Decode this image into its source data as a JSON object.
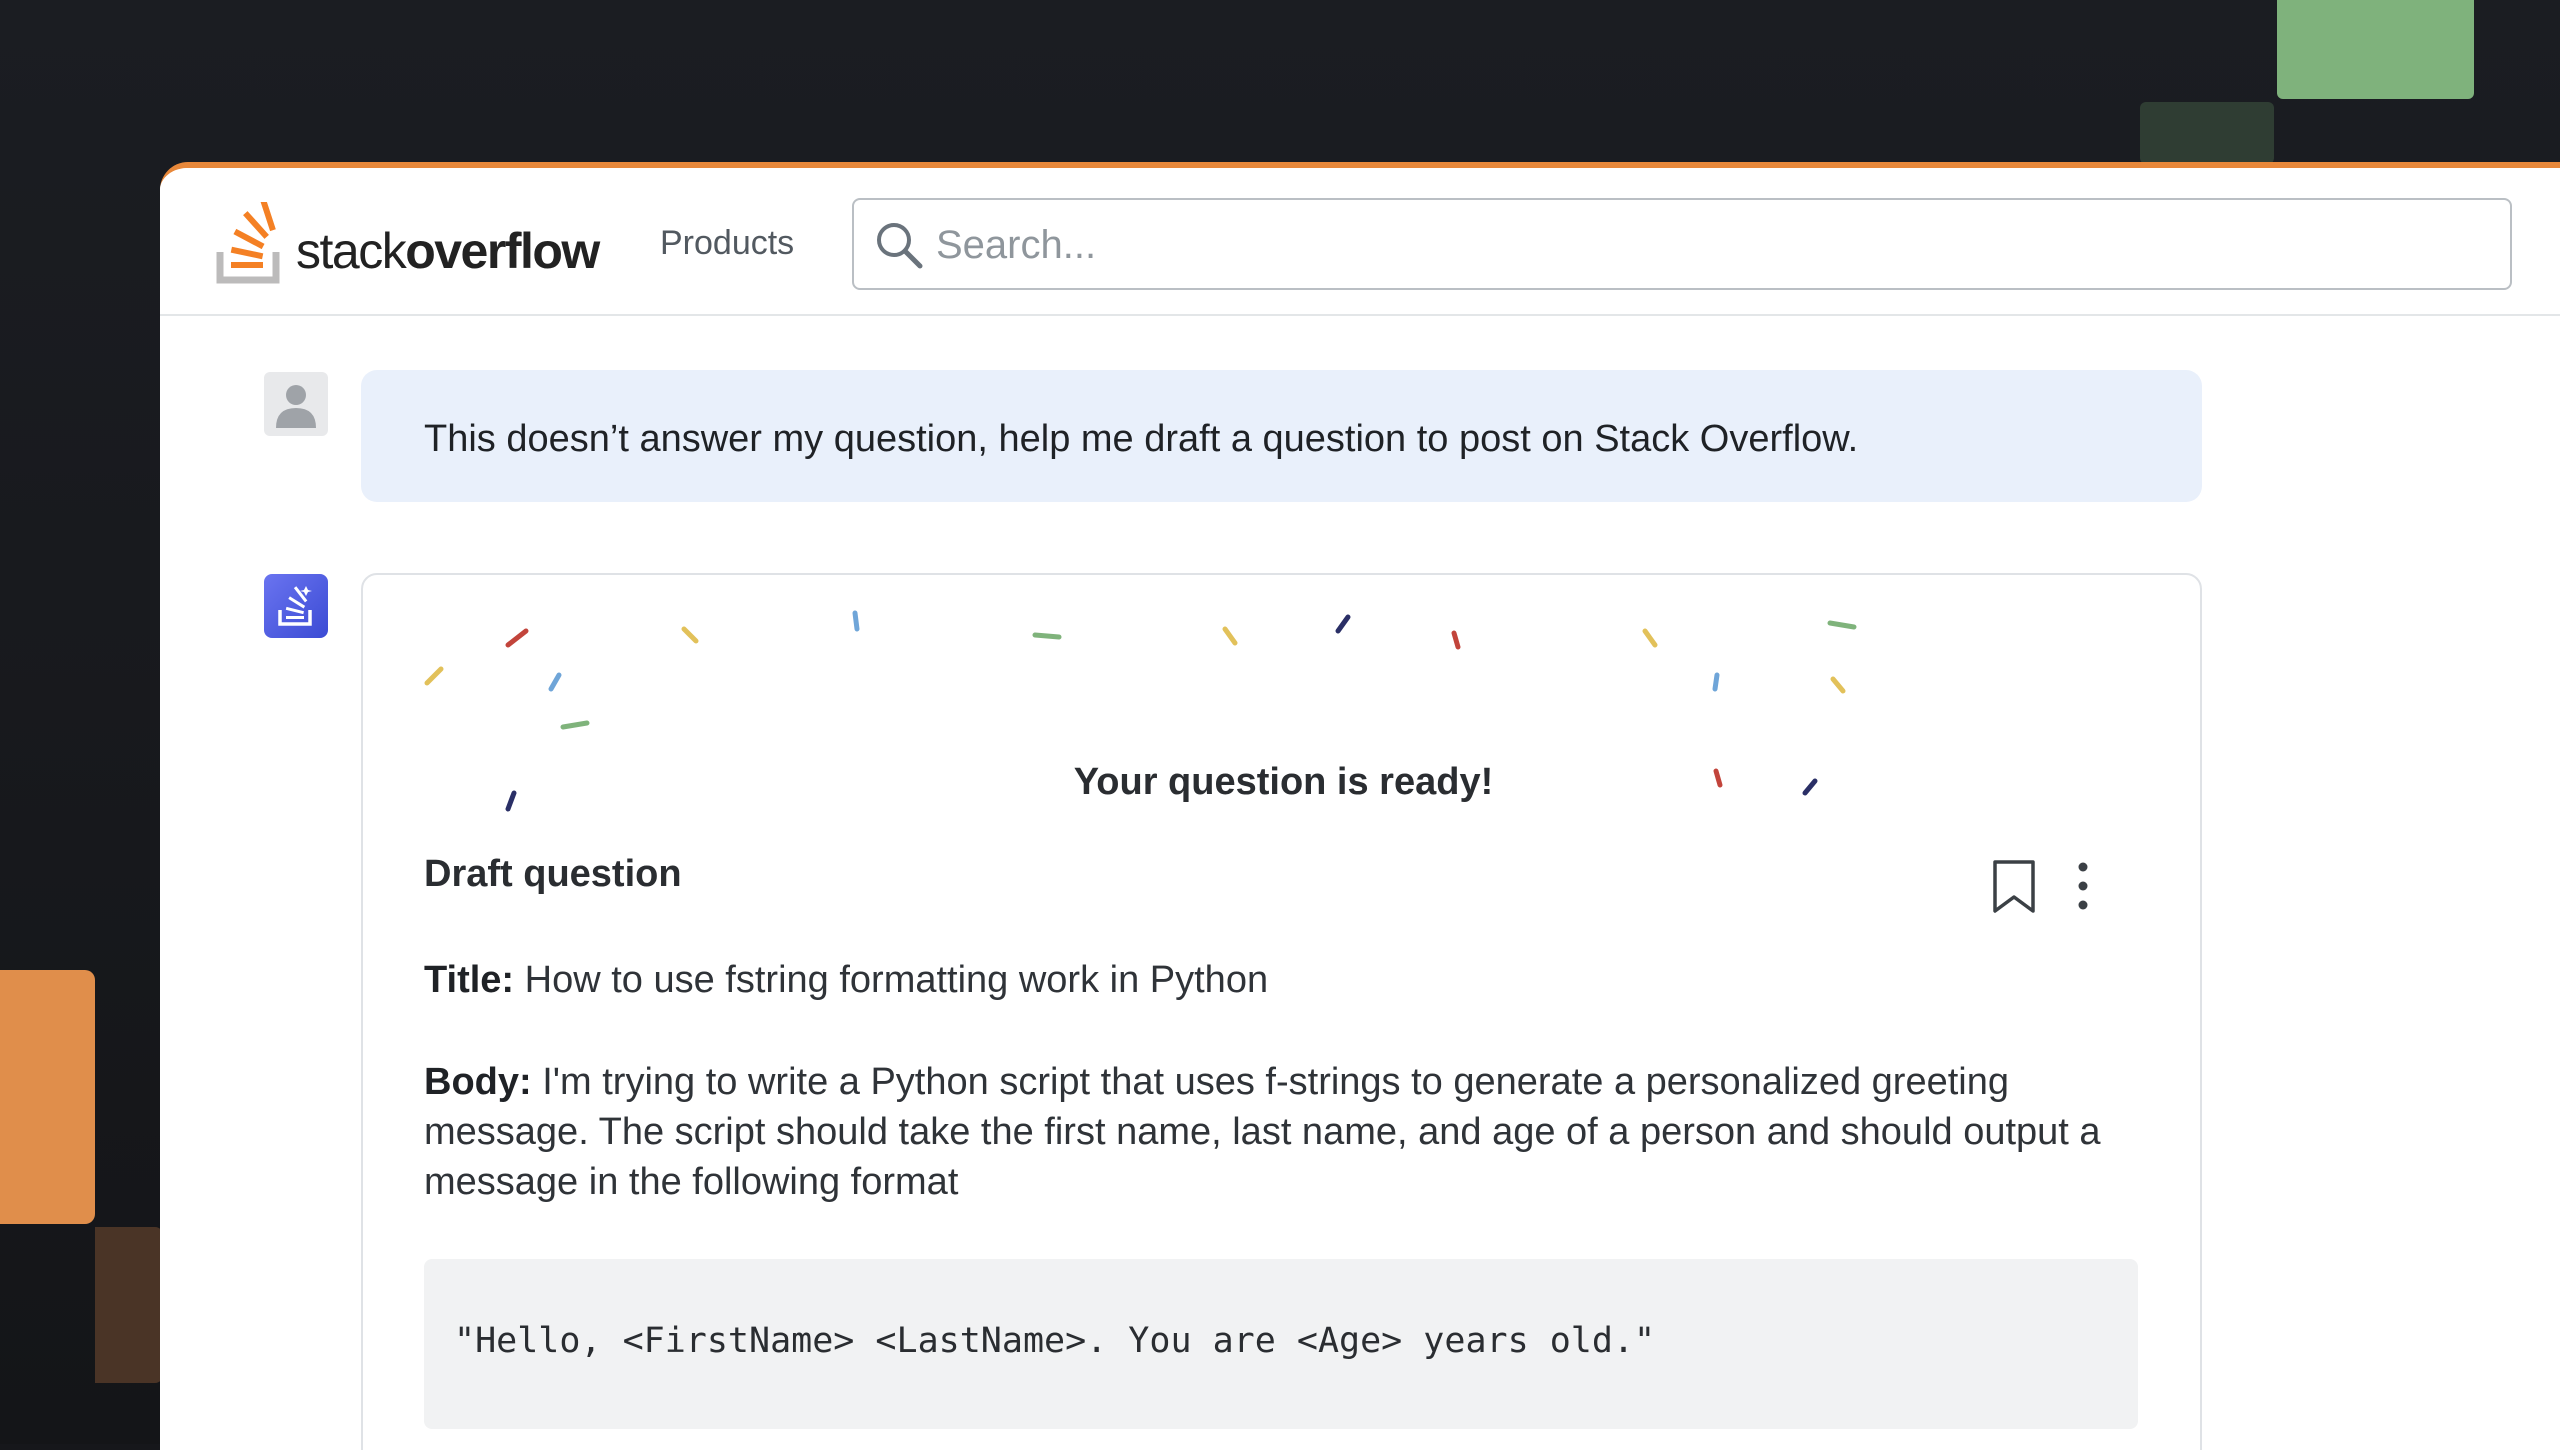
{
  "header": {
    "logo_light": "stack",
    "logo_bold": "overflow",
    "products_label": "Products",
    "search_placeholder": "Search..."
  },
  "chat": {
    "user_message": "This doesn’t answer my question, help me draft a question to post on Stack Overflow.",
    "ai_card": {
      "ready_title": "Your question is ready!",
      "draft_heading": "Draft question",
      "title_label": "Title:",
      "title_value": "How to use fstring formatting work in Python",
      "body_label": "Body:",
      "body_value": "I'm trying to write a Python script that uses f-strings to generate a personalized greeting message. The script should take the first name, last name, and age of a person and should output a message in the following format",
      "code_sample": "\"Hello, <FirstName> <LastName>. You are <Age> years old.\""
    }
  },
  "colors": {
    "accent": "#e8883a",
    "user_bubble": "#e9f0fb",
    "ai_avatar": "#4b5ae0"
  },
  "icons": [
    "stackoverflow-logo-icon",
    "search-icon",
    "user-avatar-icon",
    "ai-avatar-icon",
    "bookmark-icon",
    "more-vertical-icon"
  ]
}
